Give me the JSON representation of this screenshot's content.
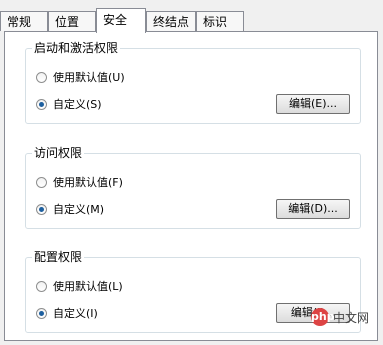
{
  "tabs": [
    {
      "label": "常规"
    },
    {
      "label": "位置"
    },
    {
      "label": "安全",
      "active": true
    },
    {
      "label": "终结点"
    },
    {
      "label": "标识"
    }
  ],
  "groups": [
    {
      "title": "启动和激活权限",
      "option_default": "使用默认值(U)",
      "option_custom": "自定义(S)",
      "selected": "custom",
      "button": "编辑(E)..."
    },
    {
      "title": "访问权限",
      "option_default": "使用默认值(F)",
      "option_custom": "自定义(M)",
      "selected": "custom",
      "button": "编辑(D)..."
    },
    {
      "title": "配置权限",
      "option_default": "使用默认值(L)",
      "option_custom": "自定义(I)",
      "selected": "custom",
      "button": "编辑(I)..."
    }
  ],
  "watermark": {
    "text": "中文网",
    "logo": "php"
  }
}
